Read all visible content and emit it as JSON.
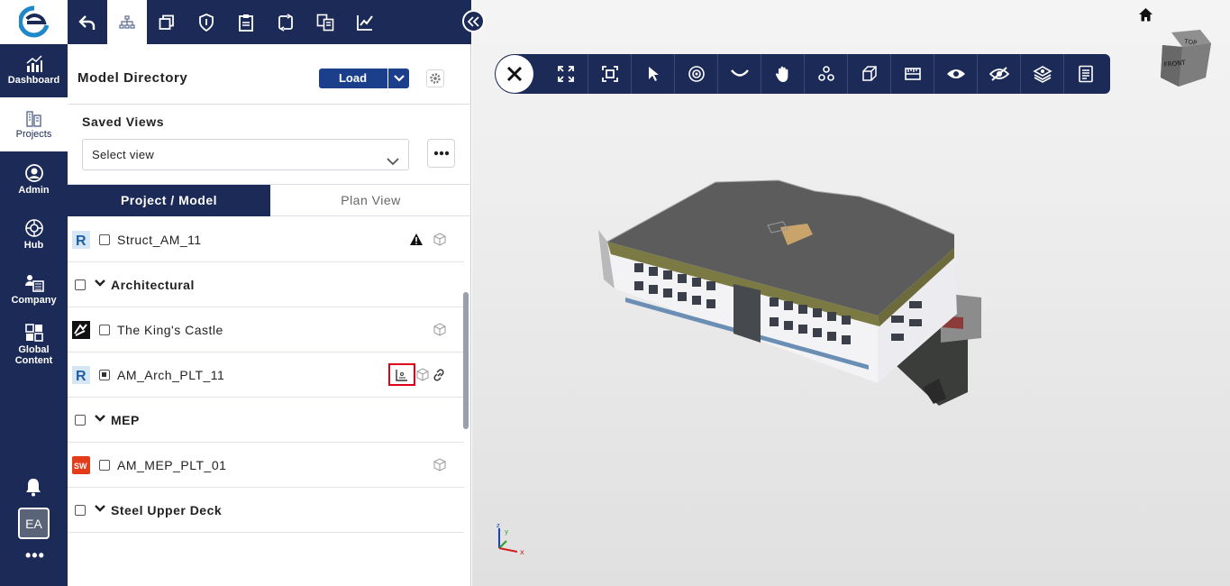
{
  "nav": {
    "items": [
      {
        "label": "Dashboard"
      },
      {
        "label": "Projects"
      },
      {
        "label": "Admin"
      },
      {
        "label": "Hub"
      },
      {
        "label": "Company"
      },
      {
        "label": "Global Content"
      }
    ],
    "avatar": "EA",
    "more": "•••"
  },
  "panel": {
    "title": "Model Directory",
    "load_label": "Load",
    "saved_views_title": "Saved Views",
    "saved_views_value": "Select view",
    "tabs": [
      {
        "label": "Project / Model",
        "active": true
      },
      {
        "label": "Plan View",
        "active": false
      }
    ],
    "rows": [
      {
        "label": "Struct_AM_11",
        "type": "revit"
      },
      {
        "label": "Architectural",
        "type": "group"
      },
      {
        "label": "The King's Castle",
        "type": "sketch"
      },
      {
        "label": "AM_Arch_PLT_11",
        "type": "revit",
        "checked": "partial"
      },
      {
        "label": "MEP",
        "type": "group"
      },
      {
        "label": "AM_MEP_PLT_01",
        "type": "solidworks"
      },
      {
        "label": "Steel Upper Deck",
        "type": "group"
      }
    ]
  },
  "viewer": {
    "viewcube_top": "TOP",
    "viewcube_front": "FRONT",
    "axis_x": "x",
    "axis_y": "y",
    "axis_z": "z"
  },
  "colors": {
    "navy": "#1b2a56",
    "load_button": "#1b3f8a",
    "highlight": "#e0001b"
  }
}
